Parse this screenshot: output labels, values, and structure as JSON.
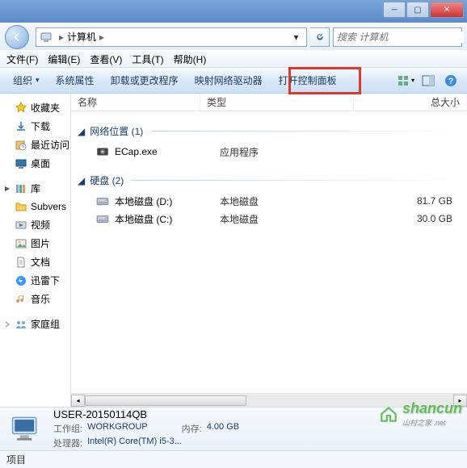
{
  "titlebar": {
    "min": "─",
    "max": "▢",
    "close": "✕"
  },
  "address": {
    "location": "计算机",
    "arrow": "▸"
  },
  "search": {
    "placeholder": "搜索 计算机"
  },
  "menu": {
    "file": "文件(F)",
    "edit": "编辑(E)",
    "view": "查看(V)",
    "tools": "工具(T)",
    "help": "帮助(H)"
  },
  "toolbar": {
    "organize": "组织",
    "sysprops": "系统属性",
    "uninstall": "卸载或更改程序",
    "mapdrive": "映射网络驱动器",
    "controlpanel": "打开控制面板"
  },
  "sidebar": {
    "favorites": "收藏夹",
    "downloads": "下载",
    "recent": "最近访问",
    "desktop": "桌面",
    "libraries": "库",
    "subvers": "Subvers",
    "videos": "视频",
    "pictures": "图片",
    "documents": "文档",
    "xunlei": "迅雷下",
    "music": "音乐",
    "homegroup": "家庭组"
  },
  "columns": {
    "name": "名称",
    "type": "类型",
    "total": "总大小"
  },
  "groups": {
    "network": {
      "label": "网络位置",
      "count": "(1)"
    },
    "disks": {
      "label": "硬盘",
      "count": "(2)"
    }
  },
  "items": {
    "ecap": {
      "name": "ECap.exe",
      "type": "应用程序"
    },
    "d": {
      "name": "本地磁盘 (D:)",
      "type": "本地磁盘",
      "size": "81.7 GB"
    },
    "c": {
      "name": "本地磁盘 (C:)",
      "type": "本地磁盘",
      "size": "30.0 GB"
    }
  },
  "details": {
    "title": "USER-20150114QB",
    "workgroup_k": "工作组:",
    "workgroup_v": "WORKGROUP",
    "memory_k": "内存:",
    "memory_v": "4.00 GB",
    "cpu_k": "处理器:",
    "cpu_v": "Intel(R) Core(TM) i5-3..."
  },
  "status": {
    "label": "项目"
  },
  "watermark": {
    "text": "shancun",
    "sub": "山村之家 .net"
  }
}
